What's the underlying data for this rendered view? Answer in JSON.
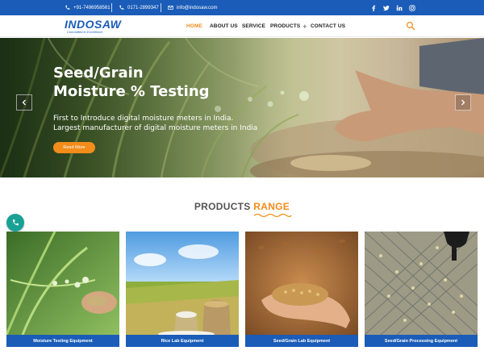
{
  "topbar": {
    "phone1": "+91-7496958561",
    "phone2": "0171-2899347",
    "email": "info@indosaw.com",
    "social": [
      "facebook-icon",
      "twitter-icon",
      "linkedin-icon",
      "instagram-icon"
    ]
  },
  "header": {
    "logo": "INDOSAW",
    "tagline": "Committed to Excellence",
    "nav": [
      {
        "label": "HOME",
        "active": true
      },
      {
        "label": "ABOUT US"
      },
      {
        "label": "SERVICE"
      },
      {
        "label": "PRODUCTS",
        "has_submenu": true,
        "submenu_icon": "+"
      },
      {
        "label": "CONTACT US"
      }
    ]
  },
  "hero": {
    "title_line1": "Seed/Grain",
    "title_line2": "Moisture % Testing",
    "subtitle_line1": "First to Introduce digital moisture meters in India.",
    "subtitle_line2": "Largest manufacturer of digital moisture meters in India",
    "button": "Read More"
  },
  "products": {
    "title_main": "PRODUCTS",
    "title_accent": "RANGE",
    "cards": [
      {
        "label": "Moisture Testing Equipment"
      },
      {
        "label": "Rice Lab Equipment"
      },
      {
        "label": "Seed/Grain Lab Equipment"
      },
      {
        "label": "Seed/Grain Processing Equipment"
      }
    ]
  },
  "colors": {
    "primary_blue": "#1a5cb8",
    "accent_orange": "#f28c1a",
    "fab_teal": "#1aa195"
  }
}
